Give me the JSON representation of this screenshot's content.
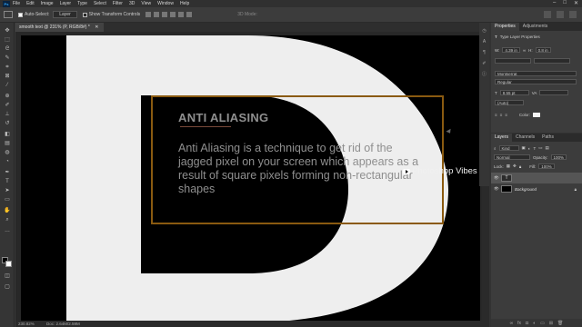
{
  "menubar": {
    "items": [
      "File",
      "Edit",
      "Image",
      "Layer",
      "Type",
      "Select",
      "Filter",
      "3D",
      "View",
      "Window",
      "Help"
    ],
    "logo": "Ps"
  },
  "options": {
    "auto_select_label": "Auto-Select:",
    "auto_select_value": "Layer",
    "transform_label": "Show Transform Controls",
    "mode_label": "3D Mode:"
  },
  "document": {
    "tab_label": "smooth text @ 231% (P, RGB/8#) *"
  },
  "canvas": {
    "heading": "ANTI ALIASING",
    "body": "Anti Aliasing is a technique to get rid of the jagged pixel on your screen which appears as a result of square pixels forming non-rectangular shapes",
    "watermark": "Photoshop Vibes",
    "colors": {
      "big_letter": "#eeeeee",
      "guide": "#8a5a10",
      "background": "#000000",
      "text": "#8f8f8f"
    }
  },
  "status": {
    "zoom": "230.82%",
    "doc": "Doc: 2.64M/2.59M"
  },
  "properties": {
    "tabs": [
      "Properties",
      "Adjustments"
    ],
    "title": "Type Layer Properties",
    "w_label": "W:",
    "w_value": "4.39 in",
    "h_label": "H:",
    "h_value": "0.8 in",
    "font_family": "Montserrat",
    "font_style": "Regular",
    "font_size": "8.55 pt",
    "leading": "(Auto)",
    "color_label": "Color:"
  },
  "layers": {
    "tabs": [
      "Layers",
      "Channels",
      "Paths"
    ],
    "kind_label": "Kind",
    "blend_mode": "Normal",
    "opacity_label": "Opacity:",
    "opacity_value": "100%",
    "lock_label": "Lock:",
    "fill_label": "Fill:",
    "fill_value": "100%",
    "items": [
      {
        "name": "T",
        "type": "text"
      },
      {
        "name": "Background",
        "type": "background"
      }
    ]
  }
}
